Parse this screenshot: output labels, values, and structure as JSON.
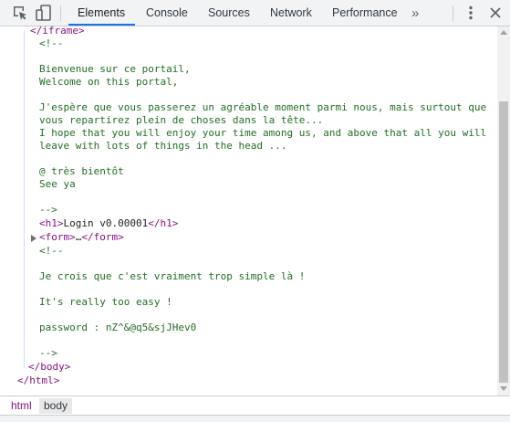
{
  "toolbar": {
    "tabs": [
      {
        "label": "Elements",
        "active": true
      },
      {
        "label": "Console"
      },
      {
        "label": "Sources"
      },
      {
        "label": "Network"
      },
      {
        "label": "Performance"
      }
    ],
    "overflow": "»",
    "icons": [
      "inspect-element-icon",
      "device-toolbar-icon",
      "more-tabs-icon",
      "kebab-menu-icon",
      "close-icon"
    ],
    "accent": "#1a73e8"
  },
  "code": {
    "iframe_close": "</iframe>",
    "comment1": [
      "<!--",
      "",
      "Bienvenue sur ce portail,",
      "Welcome on this portal,",
      "",
      "J'espère que vous passerez un agréable moment parmi nous, mais surtout que",
      "vous repartirez plein de choses dans la tête...",
      "I hope that you will enjoy your time among us, and above that all you will",
      "leave with lots of things in the head ...",
      "",
      "@ très bientôt",
      "See ya",
      "",
      "-->"
    ],
    "h1_open": "<h1>",
    "h1_text": "Login v0.00001",
    "h1_close": "</h1>",
    "form_open": "<form>",
    "form_ellipsis": "…",
    "form_close": "</form>",
    "comment2": [
      "<!--",
      "",
      "Je crois que c'est vraiment trop simple là !",
      "",
      "It's really too easy !",
      "",
      "password : nZ^&@q5&sjJHev0",
      "",
      "-->"
    ],
    "body_close": "</body>",
    "html_close": "</html>",
    "colors": {
      "tag": "#881280",
      "comment": "#236e25",
      "text": "#222222"
    }
  },
  "breadcrumb": [
    {
      "label": "html",
      "selected": false
    },
    {
      "label": "body",
      "selected": true
    }
  ]
}
